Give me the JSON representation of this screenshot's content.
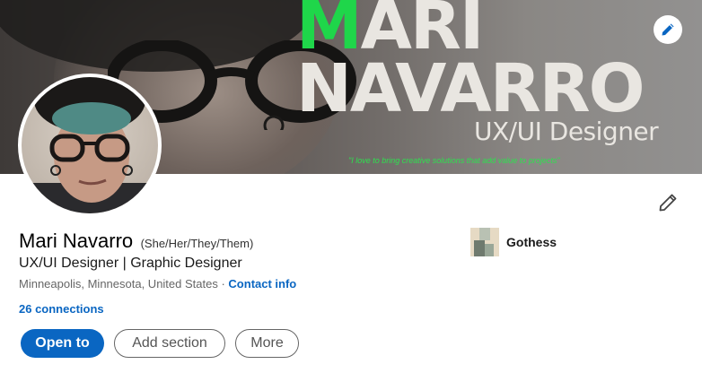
{
  "banner": {
    "title_first_letter": "M",
    "title_rest_line1": "ARI",
    "title_line2": "NAVARRO",
    "subtitle": "UX/UI Designer",
    "tagline": "\"I love to bring creative solutions that add value to projects\"",
    "edit_icon": "pencil-icon",
    "colors": {
      "accent_green": "#1fd64a",
      "title_text": "#e9e6e1"
    }
  },
  "profile": {
    "name": "Mari Navarro",
    "pronouns": "(She/Her/They/Them)",
    "headline": "UX/UI Designer | Graphic Designer",
    "location": "Minneapolis, Minnesota, United States",
    "separator": " · ",
    "contact_info": "Contact info",
    "connections": "26 connections"
  },
  "company": {
    "name": "Gothess"
  },
  "actions": {
    "open_to": "Open to",
    "add_section": "Add section",
    "more": "More"
  },
  "colors": {
    "primary_blue": "#0a66c2",
    "link_blue": "#0a66c2"
  }
}
